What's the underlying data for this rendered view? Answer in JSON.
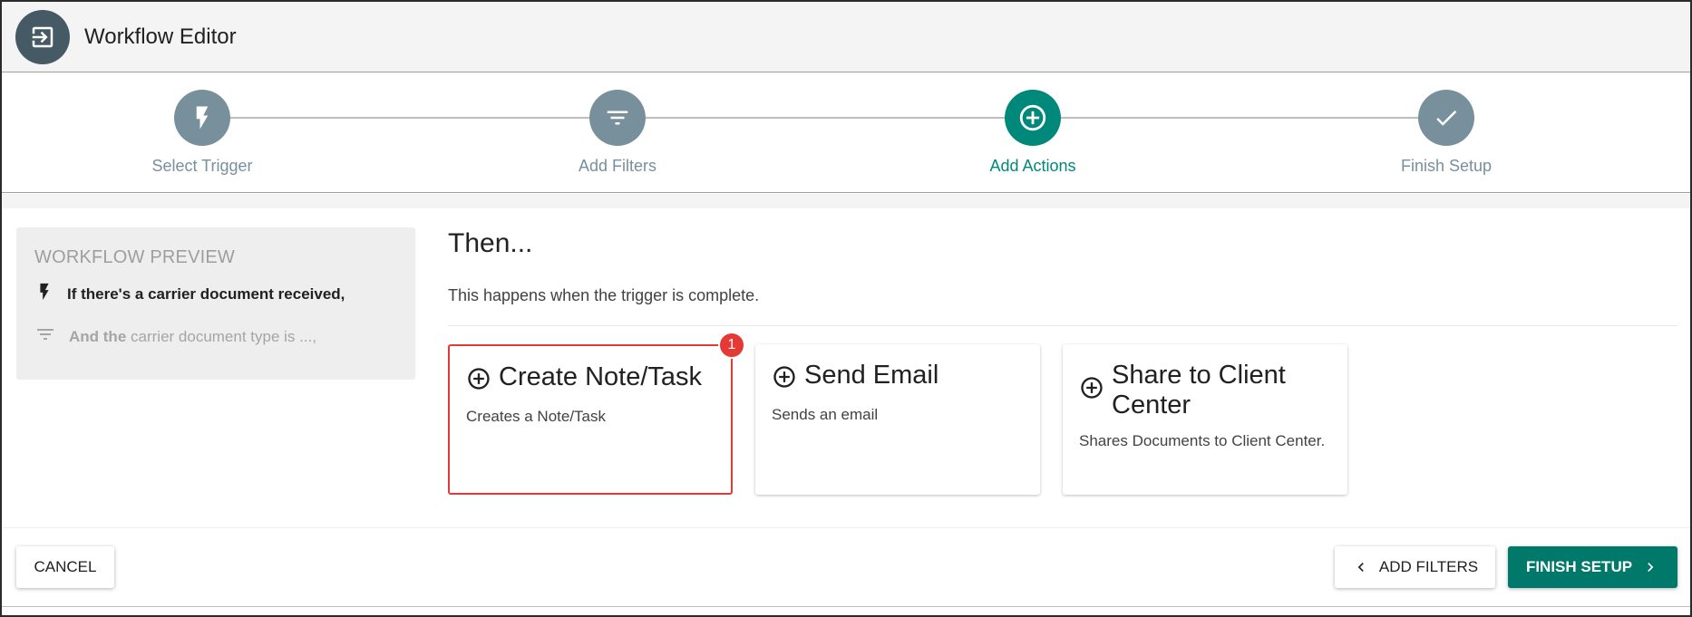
{
  "header": {
    "title": "Workflow Editor",
    "icon": "exit-to-app-icon"
  },
  "stepper": {
    "steps": [
      {
        "label": "Select Trigger",
        "icon": "bolt-icon",
        "state": "done"
      },
      {
        "label": "Add Filters",
        "icon": "filter-icon",
        "state": "done"
      },
      {
        "label": "Add Actions",
        "icon": "add-circle-icon",
        "state": "active"
      },
      {
        "label": "Finish Setup",
        "icon": "check-icon",
        "state": "pending"
      }
    ],
    "colors": {
      "inactive": "#78909c",
      "active": "#00897b"
    }
  },
  "preview": {
    "title": "WORKFLOW PREVIEW",
    "trigger_text": "If there's a carrier document received,",
    "filter_prefix": "And the",
    "filter_text": "carrier document type is ...,"
  },
  "main": {
    "heading": "Then...",
    "subtitle": "This happens when the trigger is complete.",
    "cards": [
      {
        "title": "Create Note/Task",
        "description": "Creates a Note/Task",
        "selected": true,
        "badge": "1"
      },
      {
        "title": "Send Email",
        "description": "Sends an email",
        "selected": false
      },
      {
        "title": "Share to Client Center",
        "description": "Shares Documents to Client Center.",
        "selected": false
      }
    ]
  },
  "footer": {
    "cancel_label": "CANCEL",
    "back_label": "ADD FILTERS",
    "finish_label": "FINISH SETUP",
    "accent": "#00796b"
  }
}
